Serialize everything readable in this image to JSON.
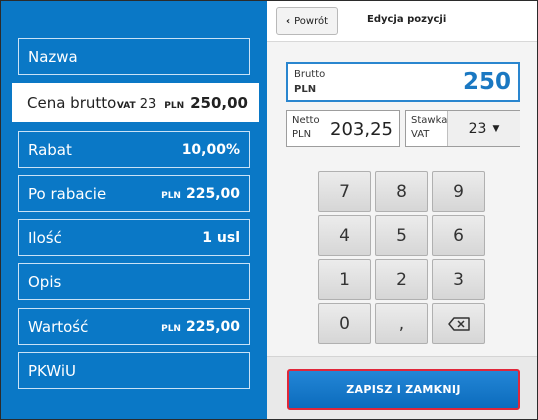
{
  "left_panel": {
    "fields": [
      {
        "label": "Nazwa"
      },
      {
        "label": "Cena brutto",
        "vat_label": "VAT",
        "vat_value": "23",
        "currency": "PLN",
        "value": "250,00"
      },
      {
        "label": "Rabat",
        "value": "10,00%"
      },
      {
        "label": "Po rabacie",
        "currency": "PLN",
        "value": "225,00"
      },
      {
        "label": "Ilość",
        "value": "1 usl"
      },
      {
        "label": "Opis"
      },
      {
        "label": "Wartość",
        "currency": "PLN",
        "value": "225,00"
      },
      {
        "label": "PKWiU"
      }
    ]
  },
  "header": {
    "back_label": "Powrót",
    "title": "Edycja pozycji"
  },
  "brutto": {
    "label": "Brutto",
    "currency": "PLN",
    "value": "250"
  },
  "netto": {
    "label": "Netto",
    "currency": "PLN",
    "value": "203,25"
  },
  "stawka": {
    "label": "Stawka",
    "sub": "VAT",
    "value": "23"
  },
  "keypad": {
    "keys": [
      "7",
      "8",
      "9",
      "4",
      "5",
      "6",
      "1",
      "2",
      "3",
      "0",
      ","
    ]
  },
  "footer": {
    "save_label": "ZAPISZ I ZAMKNIJ"
  },
  "colors": {
    "panel_blue": "#0a78c6",
    "accent_red": "#e0273a",
    "value_blue": "#1a78c2"
  }
}
